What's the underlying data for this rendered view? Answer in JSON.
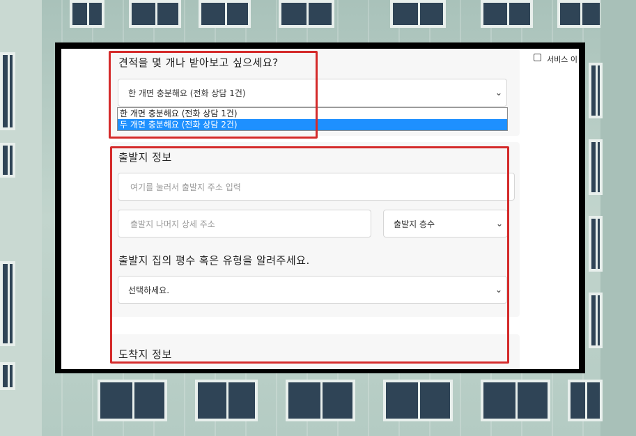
{
  "quote_count": {
    "label": "견적을 몇 개나 받아보고 싶으세요?",
    "selected": "한 개면 충분해요 (전화 상담 1건)",
    "options": [
      "한 개면 충분해요 (전화 상담 1건)",
      "두 개면 충분해요 (전화 상담 2건)"
    ],
    "highlighted_option_index": 1
  },
  "sidebar": {
    "service_checkbox_label": "서비스 이",
    "service_checkbox_checked": false
  },
  "origin": {
    "title": "출발지 정보",
    "address_placeholder": "여기를 눌러서 출발지 주소 입력",
    "detail_placeholder": "출발지 나머지 상세 주소",
    "floor_select": "출발지 층수",
    "house_question": "출발지 집의 평수 혹은 유형을 알려주세요.",
    "house_select": "선택하세요."
  },
  "destination": {
    "title": "도착지 정보"
  },
  "colors": {
    "highlight": "#1e90ff",
    "annotation_red": "#d42a2a",
    "frame": "#000000"
  },
  "icons": {
    "select_arrow": "chevron-down-icon"
  }
}
